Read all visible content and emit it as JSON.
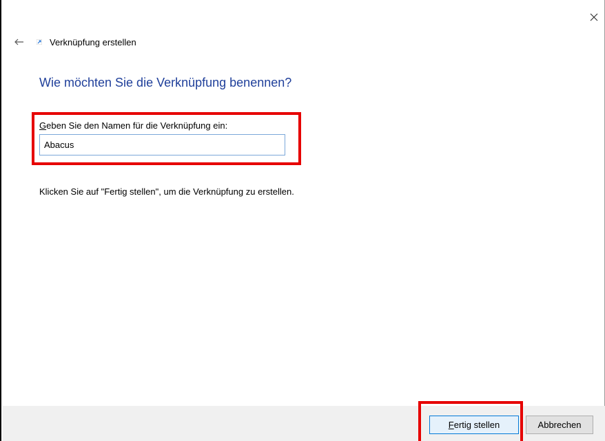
{
  "header": {
    "title": "Verknüpfung erstellen",
    "back_icon": "back-arrow-icon",
    "app_icon": "shortcut-icon",
    "close_icon": "close-icon"
  },
  "main": {
    "heading": "Wie möchten Sie die Verknüpfung benennen?",
    "field_label_accel": "G",
    "field_label_rest": "eben Sie den Namen für die Verknüpfung ein:",
    "name_value": "Abacus",
    "hint": "Klicken Sie auf \"Fertig stellen\", um die Verknüpfung zu erstellen."
  },
  "footer": {
    "finish_accel": "F",
    "finish_rest": "ertig stellen",
    "cancel_label": "Abbrechen"
  },
  "colors": {
    "heading": "#1f3f9a",
    "highlight": "#e60000",
    "input_border": "#7aa7d9"
  }
}
